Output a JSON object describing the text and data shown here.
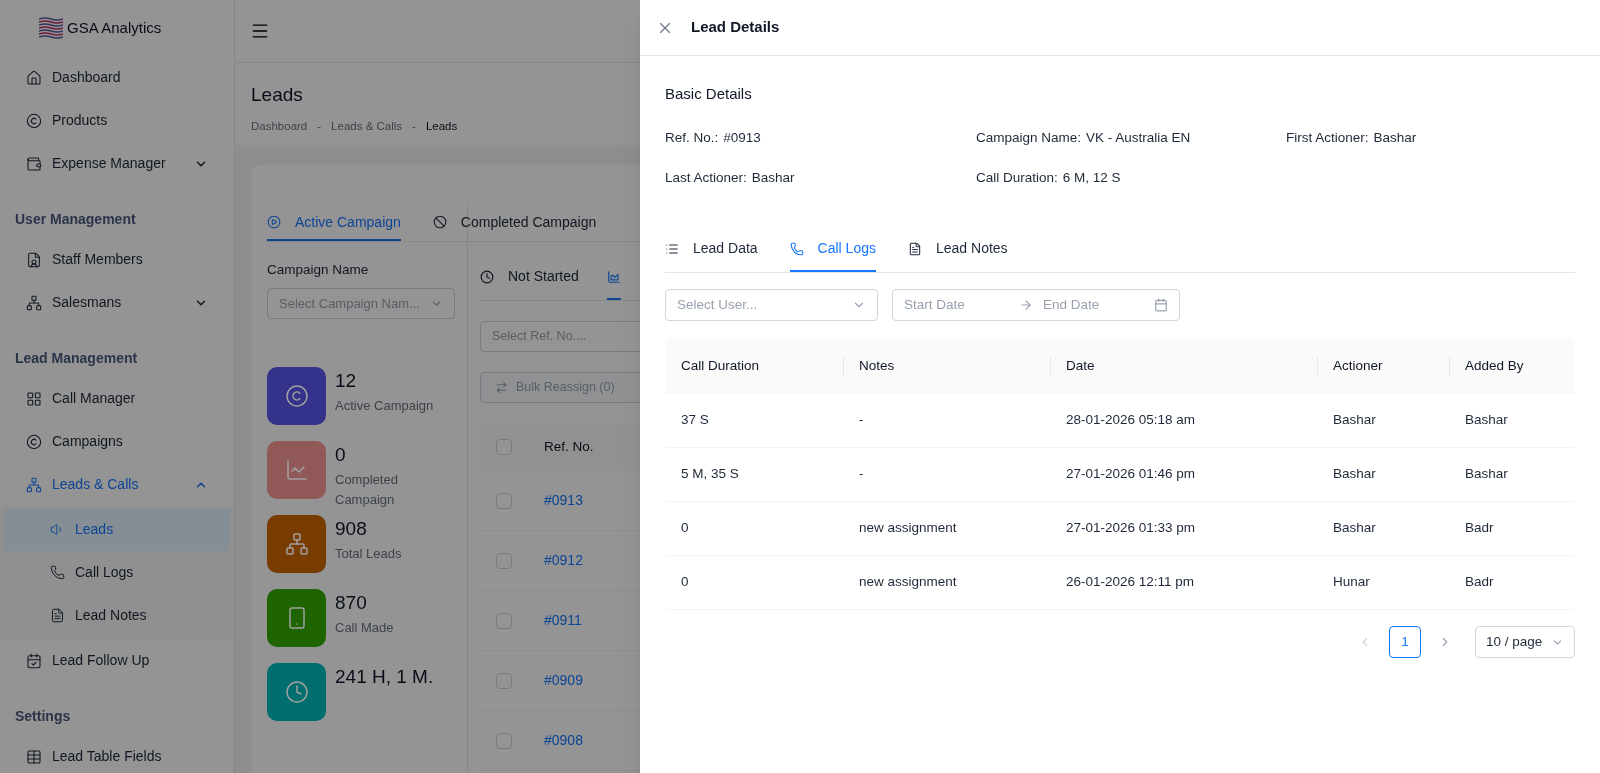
{
  "sidebar": {
    "brand": "GSA Analytics",
    "sections": [
      {
        "items": [
          {
            "label": "Dashboard",
            "selected": false
          },
          {
            "label": "Products",
            "selected": false
          },
          {
            "label": "Expense Manager",
            "selected": false,
            "expanded": false
          }
        ]
      },
      {
        "title": "User Management",
        "items": [
          {
            "label": "Staff Members",
            "selected": false
          },
          {
            "label": "Salesmans",
            "selected": false,
            "expanded": false
          }
        ]
      },
      {
        "title": "Lead Management",
        "items": [
          {
            "label": "Call Manager",
            "selected": false
          },
          {
            "label": "Campaigns",
            "selected": false
          },
          {
            "label": "Leads & Calls",
            "selected": false,
            "expanded": true,
            "children": [
              {
                "label": "Leads",
                "selected": true
              },
              {
                "label": "Call Logs",
                "selected": false
              },
              {
                "label": "Lead Notes",
                "selected": false
              }
            ]
          },
          {
            "label": "Lead Follow Up",
            "selected": false
          }
        ]
      },
      {
        "title": "Settings",
        "items": [
          {
            "label": "Lead Table Fields",
            "selected": false
          }
        ]
      }
    ]
  },
  "page": {
    "title": "Leads",
    "separator": "-",
    "breadcrumb": [
      "Dashboard",
      "Leads & Calls",
      "Leads"
    ],
    "campaign_tabs": [
      {
        "label": "Active Campaign",
        "selected": true
      },
      {
        "label": "Completed Campaign",
        "selected": false
      }
    ],
    "campaign_filter": {
      "label": "Campaign Name",
      "placeholder": "Select Campaign Nam..."
    },
    "stats": [
      {
        "value": "12",
        "label": "Active Campaign",
        "color": "#35328c"
      },
      {
        "value": "0",
        "label": "Completed Campaign",
        "color": "#915858"
      },
      {
        "value": "908",
        "label": "Total Leads",
        "color": "#783c00"
      },
      {
        "value": "870",
        "label": "Call Made",
        "color": "#1e6400"
      },
      {
        "value": "241 H, 1 M.",
        "color": "#006e6e"
      }
    ],
    "status_tabs": [
      {
        "label": "Not Started",
        "selected": false
      },
      {
        "selected": true
      }
    ],
    "ref_filter": {
      "placeholder": "Select Ref. No...."
    },
    "bulk_button": {
      "label": "Bulk Reassign (0)",
      "disabled": true
    },
    "table": {
      "all_checked": false,
      "columns": [
        "Ref. No."
      ],
      "rows": [
        {
          "ref": "#0913",
          "checked": false
        },
        {
          "ref": "#0912",
          "checked": false
        },
        {
          "ref": "#0911",
          "checked": false
        },
        {
          "ref": "#0909",
          "checked": false
        },
        {
          "ref": "#0908",
          "checked": false
        }
      ]
    }
  },
  "drawer": {
    "title": "Lead Details",
    "section": "Basic Details",
    "fields": [
      {
        "label": "Ref. No.:",
        "value": "#0913"
      },
      {
        "label": "Campaign Name:",
        "value": "VK - Australia EN"
      },
      {
        "label": "First Actioner:",
        "value": "Bashar"
      },
      {
        "label": "Last Actioner:",
        "value": "Bashar"
      },
      {
        "label": "Call Duration:",
        "value": "6 M, 12 S"
      }
    ],
    "tabs": [
      {
        "label": "Lead Data",
        "selected": false
      },
      {
        "label": "Call Logs",
        "selected": true
      },
      {
        "label": "Lead Notes",
        "selected": false
      }
    ],
    "user_filter": {
      "placeholder": "Select User..."
    },
    "date_range": {
      "start_placeholder": "Start Date",
      "end_placeholder": "End Date"
    },
    "table": {
      "columns": [
        "Call Duration",
        "Notes",
        "Date",
        "Actioner",
        "Added By"
      ],
      "rows": [
        [
          "37 S",
          "-",
          "28-01-2026 05:18 am",
          "Bashar",
          "Bashar"
        ],
        [
          "5 M, 35 S",
          "-",
          "27-01-2026 01:46 pm",
          "Bashar",
          "Bashar"
        ],
        [
          "0",
          "new assignment",
          "27-01-2026 01:33 pm",
          "Bashar",
          "Badr"
        ],
        [
          "0",
          "new assignment",
          "26-01-2026 12:11 pm",
          "Hunar",
          "Badr"
        ]
      ]
    },
    "pagination": {
      "pages": [
        {
          "label": "1",
          "selected": true
        }
      ],
      "page_size": "10 / page"
    }
  }
}
